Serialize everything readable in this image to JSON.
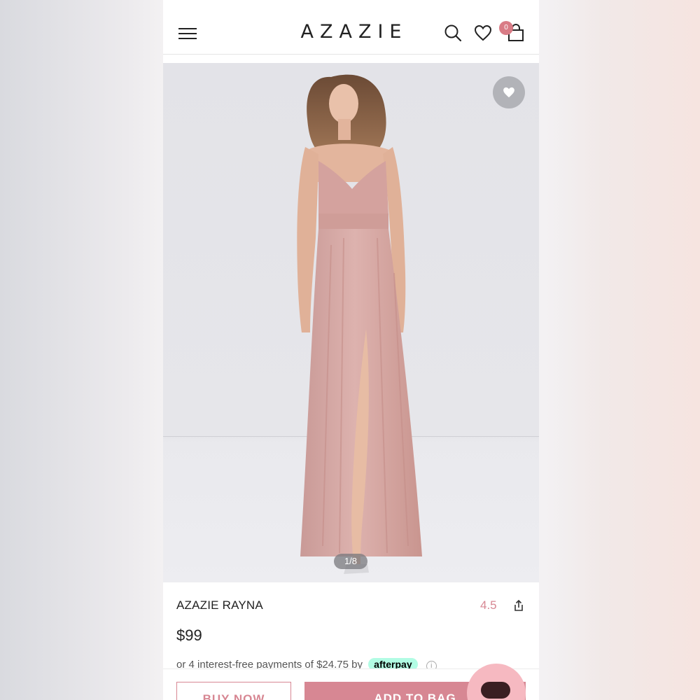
{
  "header": {
    "brand": "AZAZIE",
    "cart_count": "0",
    "icons": [
      "menu-icon",
      "search-icon",
      "heart-icon",
      "bag-icon"
    ]
  },
  "gallery": {
    "pager": "1/8",
    "favorite_icon": "heart-icon"
  },
  "product": {
    "name": "AZAZIE RAYNA",
    "rating": "4.5",
    "price": "$99",
    "installments_text": "or 4 interest-free payments of $24.75 by",
    "afterpay_label": "afterpay",
    "info_icon": "i"
  },
  "actions": {
    "buy_now": "BUY NOW",
    "add_to_bag": "ADD TO BAG"
  },
  "colors": {
    "accent": "#d78793",
    "badge": "#d97c86",
    "chat": "#f6b9c1",
    "afterpay": "#b2fce4"
  }
}
